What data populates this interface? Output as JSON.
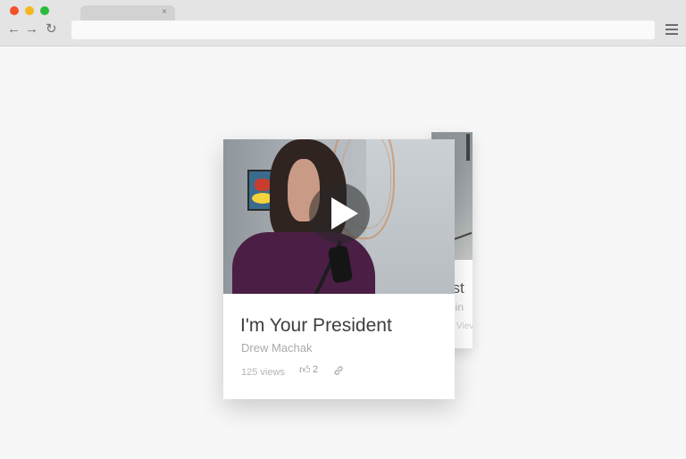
{
  "browser": {
    "tab_close": "×",
    "back_icon": "←",
    "forward_icon": "→",
    "reload_icon": "↻"
  },
  "cards": [
    {
      "title": "I'm Your President",
      "author": "Drew Machak",
      "views": "125 views",
      "likes": "2",
      "thumbnail_icon": "play-icon"
    },
    {
      "title": "ost",
      "author": "bin",
      "views": "Viev"
    }
  ]
}
